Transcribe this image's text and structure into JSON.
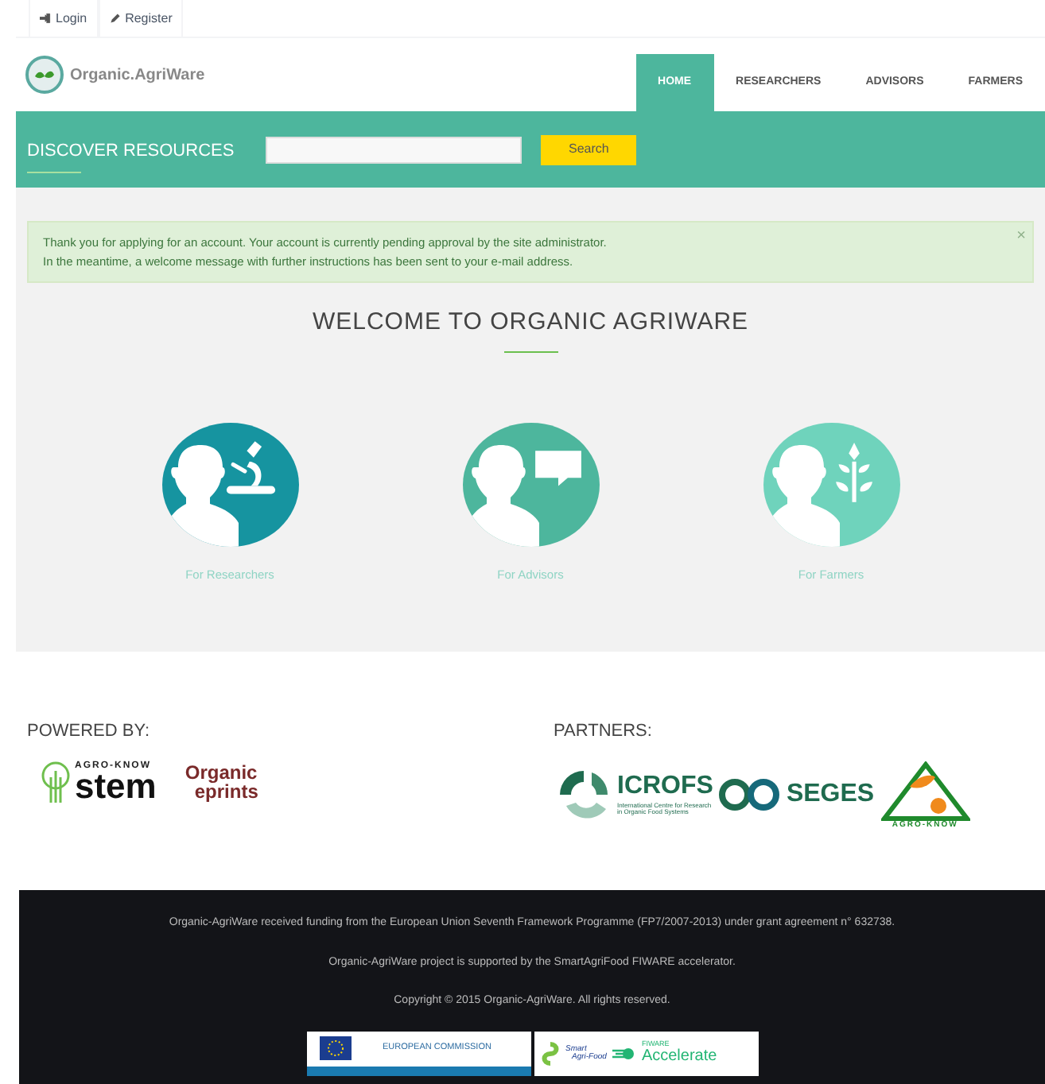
{
  "top_links": [
    {
      "label": "Login",
      "kind": "login"
    },
    {
      "label": "Register",
      "kind": "register"
    }
  ],
  "brand": {
    "name": "Organic.AgriWare"
  },
  "nav": [
    {
      "label": "HOME",
      "selected": true
    },
    {
      "label": "RESEARCHERS",
      "selected": false
    },
    {
      "label": "ADVISORS",
      "selected": false
    },
    {
      "label": "FARMERS",
      "selected": false
    }
  ],
  "discover": {
    "title": "DISCOVER RESOURCES",
    "button": "Search"
  },
  "alert": {
    "lines": [
      "Thank you for applying for an account. Your account is currently pending approval by the site administrator.",
      "In the meantime, a welcome message with further instructions has been sent to your e-mail address."
    ],
    "close": "×"
  },
  "welcome": {
    "title": "WELCOME TO ORGANIC AGRIWARE"
  },
  "audiences": [
    {
      "label": "For Researchers",
      "kind": "microscope",
      "color": "#1694a0"
    },
    {
      "label": "For Advisors",
      "kind": "speech",
      "color": "#4db69d"
    },
    {
      "label": "For Farmers",
      "kind": "plant",
      "color": "#6fd3bc"
    }
  ],
  "powered_by": {
    "title": "POWERED BY:",
    "logos": [
      {
        "kind": "stem",
        "texts": [
          "AGRO-KNOW",
          "stem"
        ]
      },
      {
        "kind": "eprints",
        "texts": [
          "Organic",
          "eprints"
        ]
      }
    ]
  },
  "partners": {
    "title": "PARTNERS:",
    "logos": [
      {
        "kind": "icrofs",
        "texts": [
          "ICROFS",
          "International Centre for Research",
          "in Organic Food Systems"
        ]
      },
      {
        "kind": "seges",
        "texts": [
          "SEGES"
        ]
      },
      {
        "kind": "agroknow",
        "texts": [
          "AGRO-KNOW"
        ]
      }
    ]
  },
  "footer": {
    "lines": [
      "Organic-AgriWare received funding from the European Union Seventh Framework Programme (FP7/2007-2013) under grant agreement n° 632738.",
      "Organic-AgriWare project is supported by the SmartAgriFood FIWARE accelerator.",
      "Copyright © 2015 Organic-AgriWare. All rights reserved."
    ],
    "badges": [
      {
        "kind": "ec",
        "texts": [
          "EUROPEAN COMMISSION"
        ]
      },
      {
        "kind": "fiware",
        "texts": [
          "Smart",
          "Agri-Food",
          "FIWARE",
          "Accelerate"
        ]
      }
    ]
  }
}
